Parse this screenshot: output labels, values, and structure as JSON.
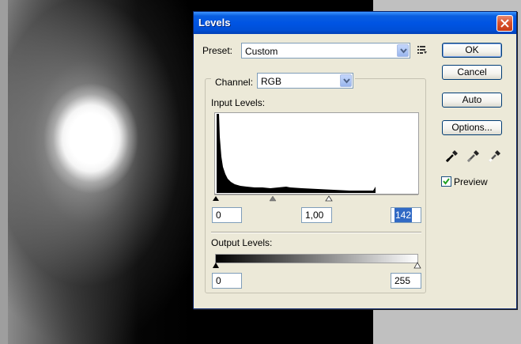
{
  "dialog": {
    "title": "Levels",
    "preset_label": "Preset:",
    "preset_value": "Custom",
    "channel_label": "Channel:",
    "channel_value": "RGB",
    "input_levels_label": "Input Levels:",
    "input_black": "0",
    "input_gamma": "1,00",
    "input_white": "142",
    "output_levels_label": "Output Levels:",
    "output_black": "0",
    "output_white": "255",
    "buttons": {
      "ok": "OK",
      "cancel": "Cancel",
      "auto": "Auto",
      "options": "Options..."
    },
    "preview_label": "Preview",
    "preview_checked": true,
    "icons": [
      "close-icon",
      "chevron-down-icon",
      "preset-menu-icon",
      "black-eyedropper-icon",
      "gray-eyedropper-icon",
      "white-eyedropper-icon",
      "checkmark-icon"
    ],
    "colors": {
      "titlebar": "#0054e3",
      "dialog_bg": "#ece9d8",
      "selection": "#316ac5",
      "close_button": "#d9522e"
    }
  }
}
